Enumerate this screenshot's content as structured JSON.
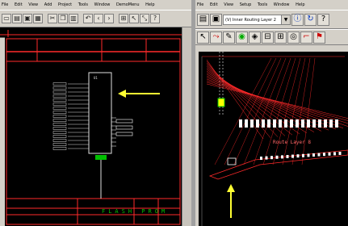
{
  "left_window": {
    "menu": [
      "File",
      "Edit",
      "View",
      "Add",
      "Project",
      "Tools",
      "Window",
      "DemoMenu",
      "Help"
    ],
    "toolbar_icons": [
      "new-icon",
      "open-icon",
      "save-icon",
      "print-icon",
      "cut-icon",
      "copy-icon",
      "paste-icon",
      "undo-icon",
      "redo-icon",
      "back-icon",
      "forward-icon",
      "zoom-icon",
      "select-icon",
      "route-icon",
      "help-icon"
    ],
    "schematic": {
      "footer_label": "FLASH PROM",
      "chip_label": "U1"
    }
  },
  "right_window": {
    "menu": [
      "File",
      "Edit",
      "View",
      "Setup",
      "Tools",
      "Window",
      "Help"
    ],
    "layer_combo_value": "(V) Inner Routing Layer 2",
    "layout_label": "Route Layer 8",
    "colors": {
      "trace_red": "#ff2a2a",
      "highlight_white": "#ffffff",
      "arrow_yellow": "#ffff33"
    }
  },
  "annotations": {
    "arrow_left_direction": "left",
    "arrow_right_direction": "up"
  }
}
